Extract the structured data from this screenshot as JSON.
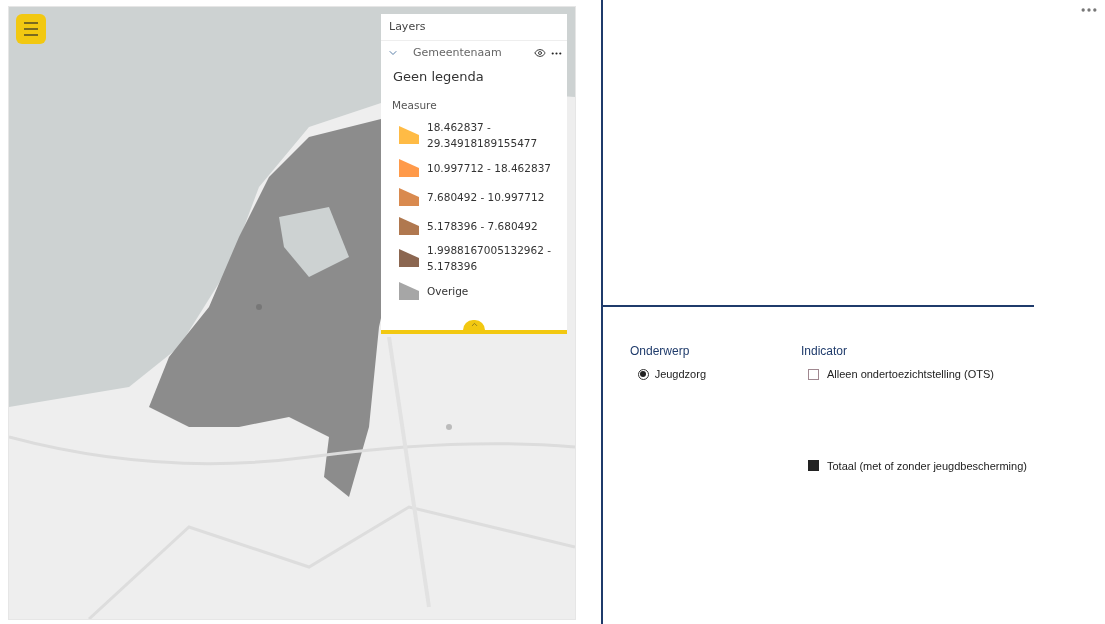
{
  "legend": {
    "title": "Layers",
    "layer": {
      "name": "Gemeentenaam",
      "expanded": true
    },
    "note": "Geen legenda",
    "measure_label": "Measure",
    "entries": [
      {
        "label": "18.462837 - 29.34918189155477",
        "color": "#ffbb45"
      },
      {
        "label": "10.997712 - 18.462837",
        "color": "#ff9a4a"
      },
      {
        "label": "7.680492 - 10.997712",
        "color": "#d98a4f"
      },
      {
        "label": "5.178396 - 7.680492",
        "color": "#b0784f"
      },
      {
        "label": "1.9988167005132962 - 5.178396",
        "color": "#8b6650"
      },
      {
        "label": "Overige",
        "color": "#a6a6a6"
      }
    ]
  },
  "onderwerp": {
    "title": "Onderwerp",
    "options": [
      {
        "label": "Jeugdzorg",
        "selected": true
      }
    ]
  },
  "indicator": {
    "title": "Indicator",
    "options": [
      {
        "label": "Alleen ondertoezichtstelling (OTS)",
        "checked": false
      },
      {
        "label": "Totaal (met of zonder jeugdbescherming)",
        "checked": true
      }
    ]
  }
}
